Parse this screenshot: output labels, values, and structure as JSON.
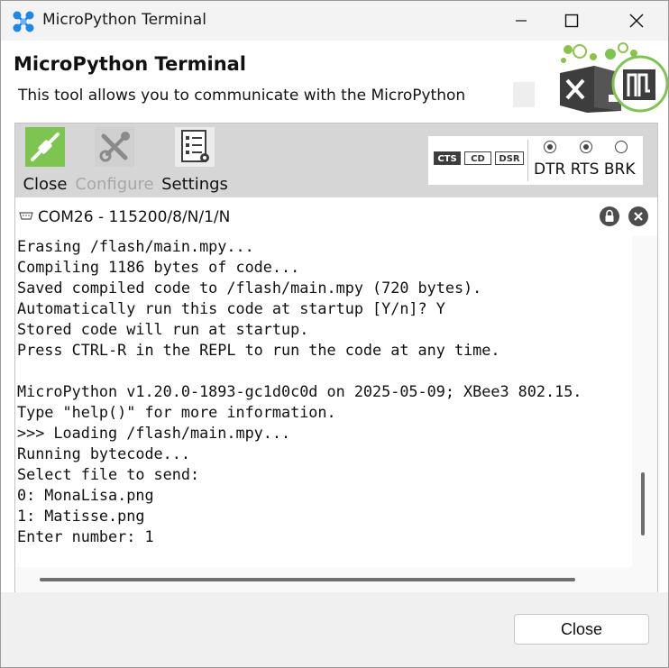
{
  "window": {
    "title": "MicroPython Terminal"
  },
  "header": {
    "title": "MicroPython Terminal",
    "description": "This tool allows you to communicate with the MicroPython",
    "logo_icon": "micropython-logo-icon"
  },
  "toolbar": {
    "buttons": [
      {
        "label": "Close",
        "icon": "plug-icon",
        "enabled": true
      },
      {
        "label": "Configure",
        "icon": "tools-icon",
        "enabled": false
      },
      {
        "label": "Settings",
        "icon": "settings-checklist-icon",
        "enabled": true
      }
    ]
  },
  "signals": {
    "indicators": [
      "CTS",
      "CD",
      "DSR"
    ],
    "active_indicator": "CTS",
    "lines": [
      {
        "label": "DTR",
        "on": true
      },
      {
        "label": "RTS",
        "on": true
      },
      {
        "label": "BRK",
        "on": false
      }
    ],
    "labels_text": "DTR RTS BRK"
  },
  "connection": {
    "text": "COM26 - 115200/8/N/1/N"
  },
  "terminal": {
    "lines": [
      "Erasing /flash/main.mpy...",
      "Compiling 1186 bytes of code...",
      "Saved compiled code to /flash/main.mpy (720 bytes).",
      "Automatically run this code at startup [Y/n]? Y",
      "Stored code will run at startup.",
      "Press CTRL-R in the REPL to run the code at any time.",
      "",
      "MicroPython v1.20.0-1893-gc1d0c0d on 2025-05-09; XBee3 802.15.",
      "Type \"help()\" for more information.",
      ">>> Loading /flash/main.mpy...",
      "Running bytecode...",
      "Select file to send:",
      "0: MonaLisa.png",
      "1: Matisse.png",
      "Enter number: 1"
    ]
  },
  "footer": {
    "close_label": "Close"
  },
  "colors": {
    "accent_green": "#7ec450",
    "toolbar_bg": "#d6d6d6",
    "logo_dark": "#3d3d3d"
  }
}
